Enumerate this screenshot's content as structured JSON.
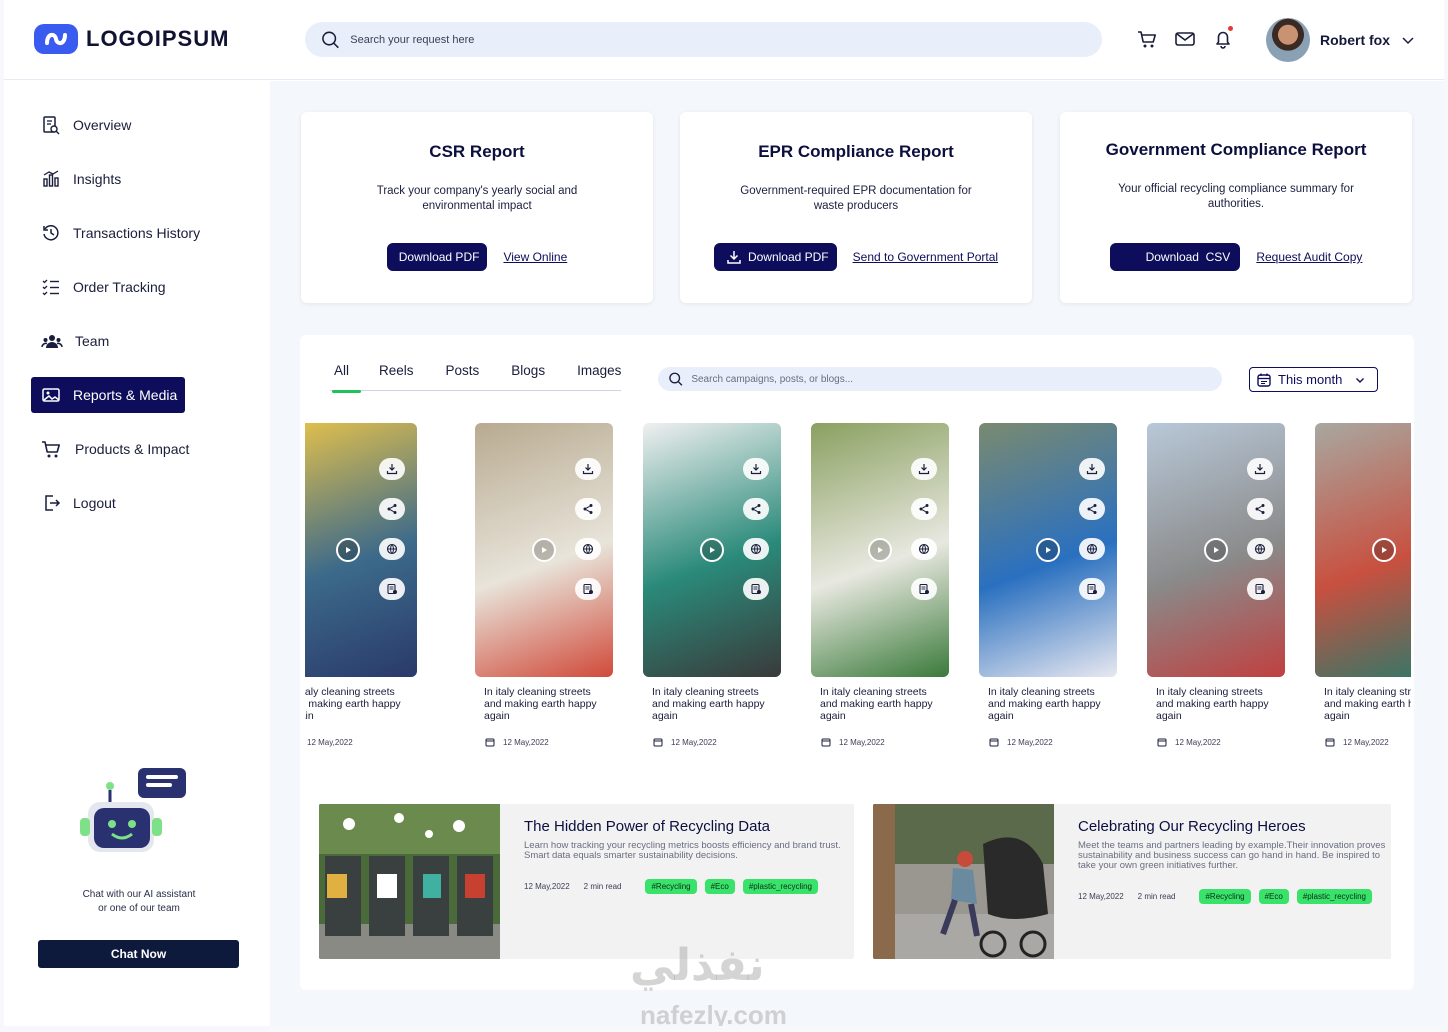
{
  "header": {
    "logo_text": "LOGOIPSUM",
    "search_placeholder": "Search your request here",
    "user_name": "Robert fox"
  },
  "sidebar": {
    "items": [
      {
        "label": "Overview",
        "icon": "report-search-icon",
        "active": false
      },
      {
        "label": "Insights",
        "icon": "bar-chart-icon",
        "active": false
      },
      {
        "label": "Transactions History",
        "icon": "history-clock-icon",
        "active": false
      },
      {
        "label": "Order Tracking",
        "icon": "checklist-icon",
        "active": false
      },
      {
        "label": "Team",
        "icon": "team-icon",
        "active": false
      },
      {
        "label": "Reports & Media",
        "icon": "image-icon",
        "active": true
      },
      {
        "label": "Products & Impact",
        "icon": "cart-icon",
        "active": false
      },
      {
        "label": "Logout",
        "icon": "logout-icon",
        "active": false
      }
    ],
    "chat_text_1": "Chat with our AI assistant",
    "chat_text_2": "or one of our team",
    "chat_button": "Chat Now"
  },
  "reports": [
    {
      "title": "CSR Report",
      "desc": "Track your company's yearly social and environmental impact",
      "button": "Download PDF",
      "link": "View Online"
    },
    {
      "title": "EPR Compliance Report",
      "desc": "Government-required EPR documentation for waste producers",
      "button": "Download PDF",
      "link": "Send to Government Portal"
    },
    {
      "title": "Government Compliance Report",
      "desc": "Your official recycling compliance summary for authorities.",
      "button": "Download  CSV",
      "link": "Request Audit Copy"
    }
  ],
  "media": {
    "tabs": [
      "All",
      "Reels",
      "Posts",
      "Blogs",
      "Images"
    ],
    "search_placeholder": "Search campaigns, posts, or blogs...",
    "filter": "This month",
    "cards": [
      {
        "caption": "In italy cleaning streets and making earth happy again",
        "date": "12 May,2022"
      },
      {
        "caption": "In italy cleaning streets and making earth happy again",
        "date": "12 May,2022"
      },
      {
        "caption": "In italy cleaning streets and making earth happy again",
        "date": "12 May,2022"
      },
      {
        "caption": "In italy cleaning streets and making earth happy again",
        "date": "12 May,2022"
      },
      {
        "caption": "In italy cleaning streets and making earth happy again",
        "date": "12 May,2022"
      },
      {
        "caption": "In italy cleaning streets and making earth happy again",
        "date": "12 May,2022"
      },
      {
        "caption": "In italy cleaning streets and making earth happy again",
        "date": "12 May,2022"
      }
    ],
    "blogs": [
      {
        "title": "The Hidden Power of Recycling Data",
        "desc": "Learn how tracking your recycling metrics boosts efficiency and brand trust. Smart data equals smarter sustainability decisions.",
        "date": "12 May,2022",
        "read": "2 min read",
        "tags": [
          "#Recycling",
          "#Eco",
          "#plastic_recycling"
        ]
      },
      {
        "title": "Celebrating Our Recycling Heroes",
        "desc": "Meet the teams and partners leading by example.Their innovation proves sustainability and business success can go hand in hand. Be inspired to take your own green initiatives further.",
        "date": "12 May,2022",
        "read": "2 min read",
        "tags": [
          "#Recycling",
          "#Eco",
          "#plastic_recycling"
        ]
      }
    ]
  },
  "watermark": {
    "arabic": "نفذلي",
    "latin": "nafezly.com"
  },
  "colors": {
    "primary": "#0d0d5c",
    "accent_green": "#39e26a",
    "search_bg": "#e8eefa"
  }
}
